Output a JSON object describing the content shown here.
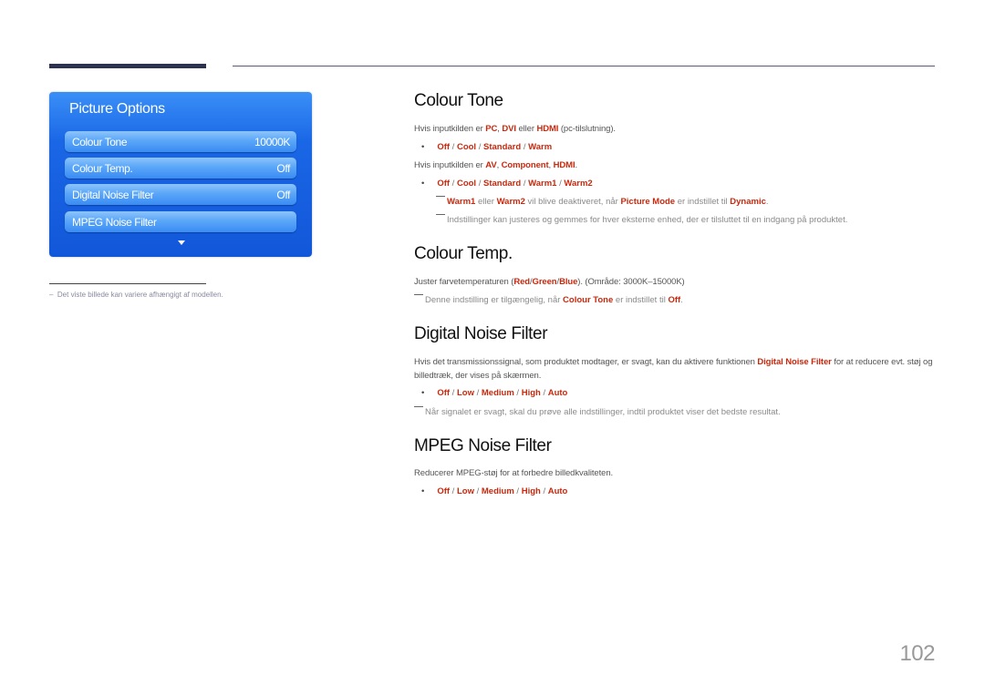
{
  "osd": {
    "title": "Picture Options",
    "items": [
      {
        "label": "Colour Tone",
        "value": "10000K"
      },
      {
        "label": "Colour Temp.",
        "value": "Off"
      },
      {
        "label": "Digital Noise Filter",
        "value": "Off"
      },
      {
        "label": "MPEG Noise Filter",
        "value": ""
      }
    ],
    "scroll_icon": "arrow-down-icon"
  },
  "footnote": "Det viste billede kan variere afhængigt af modellen.",
  "footnote_marker": "–",
  "sections": {
    "colour_tone": {
      "title": "Colour Tone",
      "line1": {
        "pre": "Hvis inputkilden er ",
        "a": "PC",
        "s1": ", ",
        "b": "DVI",
        "s2": " eller ",
        "c": "HDMI",
        "post": " (pc-tilslutning)."
      },
      "options1": [
        "Off",
        "Cool",
        "Standard",
        "Warm"
      ],
      "line2": {
        "pre": "Hvis inputkilden er ",
        "a": "AV",
        "s1": ", ",
        "b": "Component",
        "s2": ", ",
        "c": "HDMI",
        "post": "."
      },
      "options2": [
        "Off",
        "Cool",
        "Standard",
        "Warm1",
        "Warm2"
      ],
      "note1": {
        "a": "Warm1",
        "s1": " eller ",
        "b": "Warm2",
        "s2": " vil blive deaktiveret, når ",
        "c": "Picture Mode",
        "s3": " er indstillet til ",
        "d": "Dynamic",
        "post": "."
      },
      "note2": "Indstillinger kan justeres og gemmes for hver eksterne enhed, der er tilsluttet til en indgang på produktet."
    },
    "colour_temp": {
      "title": "Colour Temp.",
      "line": {
        "pre": "Juster farvetemperaturen (",
        "a": "Red",
        "s1": "/",
        "b": "Green",
        "s2": "/",
        "c": "Blue",
        "post": "). (Område: 3000K–15000K)"
      },
      "note": {
        "pre": "Denne indstilling er tilgængelig, når ",
        "a": "Colour Tone",
        "s1": " er indstillet til ",
        "b": "Off",
        "post": "."
      }
    },
    "digital_noise": {
      "title": "Digital Noise Filter",
      "line": {
        "pre": "Hvis det transmissionssignal, som produktet modtager, er svagt, kan du aktivere funktionen ",
        "a": "Digital Noise Filter",
        "post": " for at reducere evt. støj og billedtræk, der vises på skærmen."
      },
      "options": [
        "Off",
        "Low",
        "Medium",
        "High",
        "Auto"
      ],
      "note": "Når signalet er svagt, skal du prøve alle indstillinger, indtil produktet viser det bedste resultat."
    },
    "mpeg_noise": {
      "title": "MPEG Noise Filter",
      "line": "Reducerer MPEG-støj for at forbedre billedkvaliteten.",
      "options": [
        "Off",
        "Low",
        "Medium",
        "High",
        "Auto"
      ]
    }
  },
  "separator": " / ",
  "bullet": "•",
  "page_number": "102",
  "colors": {
    "accent": "#c8290e",
    "osd_blue": "#1a67e6",
    "rule": "#2d3150"
  }
}
